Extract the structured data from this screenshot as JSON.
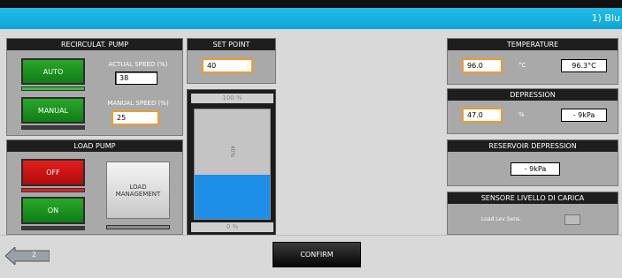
{
  "title": "1) Blu",
  "recirc_pump": {
    "header": "RECIRCULAT. PUMP",
    "auto_label": "AUTO",
    "manual_label": "MANUAL",
    "actual_speed_label": "ACTUAL SPEED (%)",
    "actual_speed_value": "38",
    "manual_speed_label": "MANUAL SPEED (%)",
    "manual_speed_value": "25"
  },
  "load_pump": {
    "header": "LOAD PUMP",
    "off_label": "OFF",
    "on_label": "ON",
    "load_mgmt_line1": "LOAD",
    "load_mgmt_line2": "MANAGEMENT"
  },
  "set_point": {
    "header": "SET POINT",
    "value": "40",
    "top_label": "100 %",
    "bottom_label": "0 %",
    "mid_label": "40%",
    "level_fraction": 0.4
  },
  "temperature": {
    "header": "TEMPERATURE",
    "input_value": "96.0",
    "unit": "°C",
    "readout": "96.3°C"
  },
  "depression": {
    "header": "DEPRESSION",
    "input_value": "47.0",
    "unit": "%",
    "readout": "- 9kPa"
  },
  "reservoir_depression": {
    "header": "RESERVOIR DEPRESSION",
    "readout": "- 9kPa"
  },
  "sensore": {
    "header": "SENSORE LIVELLO DI CARICA",
    "label": "Load Lev Sens."
  },
  "footer": {
    "back_label": "2",
    "confirm_label": "CONFIRM"
  },
  "colors": {
    "accent": "#12aee0",
    "green": "#1a9a1f",
    "red": "#d41414",
    "tank_fill": "#1e8fe8",
    "field_border": "#f09a2c"
  }
}
